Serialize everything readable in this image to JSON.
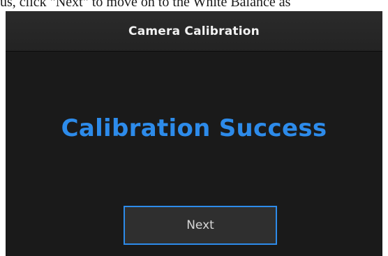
{
  "document": {
    "caption": "us, click \"Next\" to move on to the White Balance as"
  },
  "dialog": {
    "title": "Camera Calibration",
    "status_message": "Calibration Success",
    "next_label": "Next"
  },
  "colors": {
    "accent": "#2d8bea",
    "dialog_background": "#1a1a1a",
    "titlebar_background": "#262626"
  }
}
